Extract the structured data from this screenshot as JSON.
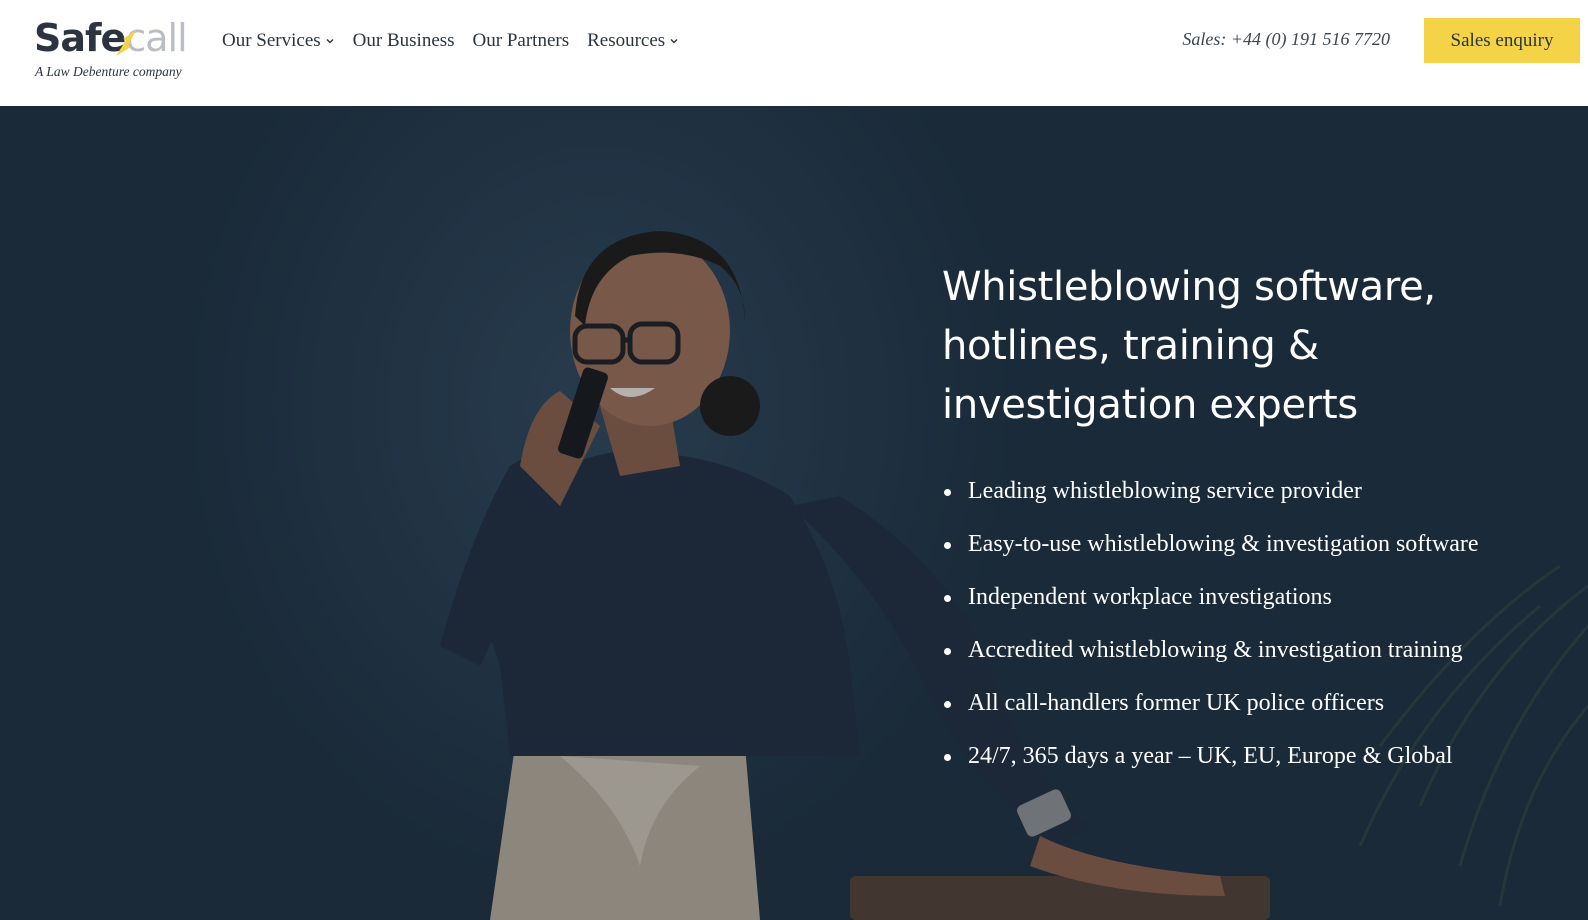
{
  "logo": {
    "part1": "Safe",
    "part2": "call",
    "tagline": "A Law Debenture company"
  },
  "nav": {
    "items": [
      {
        "label": "Our Services",
        "has_dropdown": true
      },
      {
        "label": "Our Business",
        "has_dropdown": false
      },
      {
        "label": "Our Partners",
        "has_dropdown": false
      },
      {
        "label": "Resources",
        "has_dropdown": true
      }
    ]
  },
  "header": {
    "phone": "Sales: +44 (0) 191 516 7720",
    "cta_label": "Sales enquiry"
  },
  "hero": {
    "title": "Whistleblowing software, hotlines, training & investigation experts",
    "bullets": [
      "Leading whistleblowing service provider",
      "Easy-to-use whistleblowing & investigation software",
      "Independent workplace investigations",
      "Accredited whistleblowing & investigation training",
      "All call-handlers former UK police officers",
      "24/7, 365 days a year – UK, EU, Europe & Global"
    ]
  },
  "colors": {
    "accent": "#f5d347",
    "text_dark": "#2b3440",
    "hero_bg": "#1b2b3a"
  },
  "icons": {
    "nav_dropdown": "chevron-down-icon",
    "list_bullet": "bullet-icon"
  }
}
